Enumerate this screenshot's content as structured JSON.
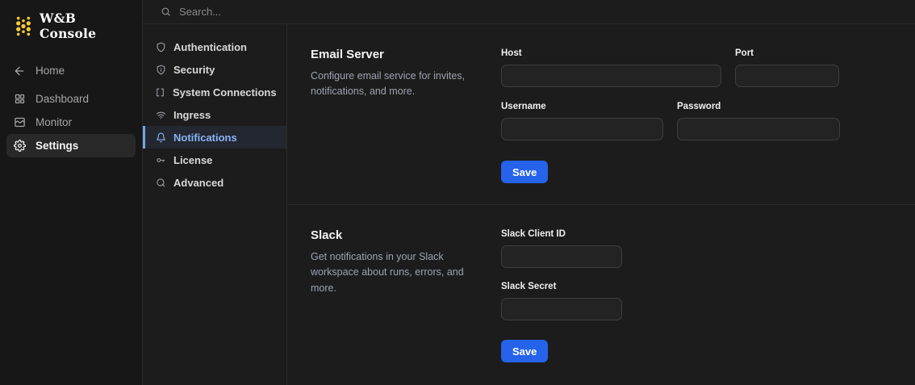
{
  "app": {
    "title": "W&B Console"
  },
  "topbar": {
    "search_placeholder": "Search..."
  },
  "sidebar": {
    "items": [
      {
        "label": "Home",
        "icon": "arrow-left-icon",
        "active": false
      },
      {
        "label": "Dashboard",
        "icon": "grid-icon",
        "active": false
      },
      {
        "label": "Monitor",
        "icon": "monitor-icon",
        "active": false
      },
      {
        "label": "Settings",
        "icon": "gear-icon",
        "active": true
      }
    ]
  },
  "settings_nav": {
    "items": [
      {
        "label": "Authentication",
        "icon": "shield-icon",
        "active": false
      },
      {
        "label": "Security",
        "icon": "shield-info-icon",
        "active": false
      },
      {
        "label": "System Connections",
        "icon": "brackets-icon",
        "active": false
      },
      {
        "label": "Ingress",
        "icon": "wifi-icon",
        "active": false
      },
      {
        "label": "Notifications",
        "icon": "bell-icon",
        "active": true
      },
      {
        "label": "License",
        "icon": "key-icon",
        "active": false
      },
      {
        "label": "Advanced",
        "icon": "advanced-icon",
        "active": false
      }
    ]
  },
  "email_section": {
    "title": "Email Server",
    "description": "Configure email service for invites, notifications, and more.",
    "fields": {
      "host": {
        "label": "Host",
        "value": ""
      },
      "port": {
        "label": "Port",
        "value": ""
      },
      "username": {
        "label": "Username",
        "value": ""
      },
      "password": {
        "label": "Password",
        "value": ""
      }
    },
    "save_label": "Save"
  },
  "slack_section": {
    "title": "Slack",
    "description": "Get notifications in your Slack workspace about runs, errors, and more.",
    "fields": {
      "client_id": {
        "label": "Slack Client ID",
        "value": ""
      },
      "secret": {
        "label": "Slack Secret",
        "value": ""
      }
    },
    "save_label": "Save"
  },
  "colors": {
    "accent_button": "#2563eb",
    "active_nav_text": "#8ab4f8",
    "active_nav_border": "#78a3de",
    "logo_gold": "#ffcc33",
    "background": "#1c1c1c",
    "sidebar_background": "#171717"
  }
}
